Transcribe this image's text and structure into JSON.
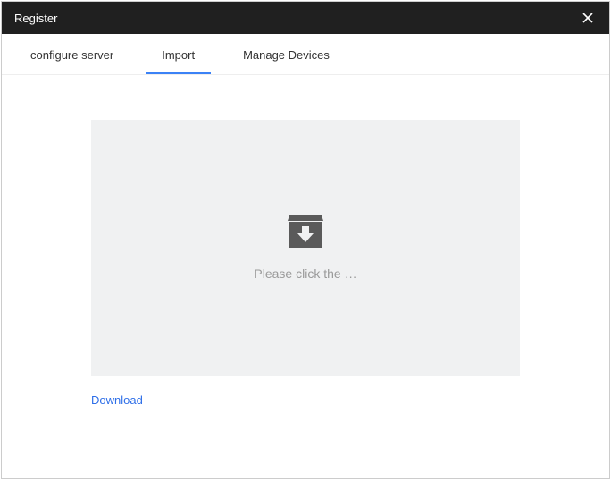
{
  "title": "Register",
  "tabs": [
    {
      "label": "configure server",
      "active": false
    },
    {
      "label": "Import",
      "active": true
    },
    {
      "label": "Manage Devices",
      "active": false
    }
  ],
  "dropzone": {
    "text": "Please click the …"
  },
  "download_link": "Download"
}
